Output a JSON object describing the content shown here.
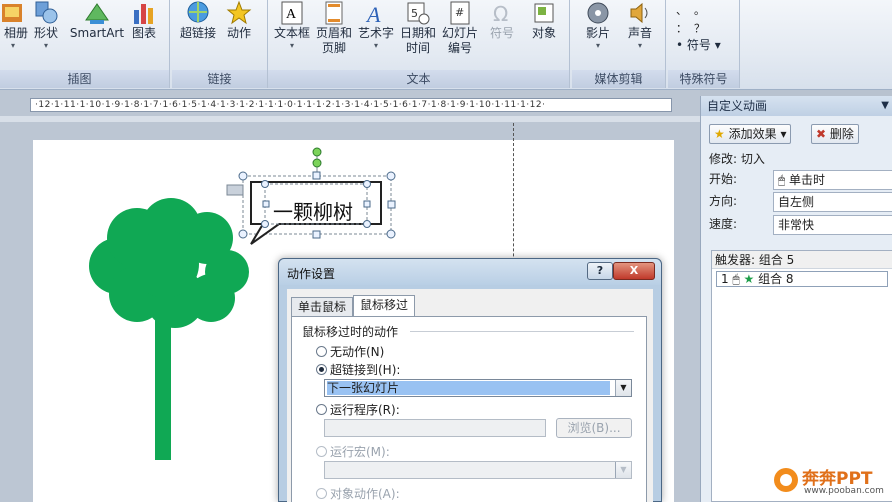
{
  "ribbon": {
    "groups": [
      {
        "label": "插图",
        "buttons": [
          {
            "label": "相册"
          },
          {
            "label": "形状"
          },
          {
            "label": "SmartArt"
          },
          {
            "label": "图表"
          }
        ]
      },
      {
        "label": "链接",
        "buttons": [
          {
            "label": "超链接"
          },
          {
            "label": "动作"
          }
        ]
      },
      {
        "label": "文本",
        "buttons": [
          {
            "label": "文本框"
          },
          {
            "label": "页眉和\n页脚"
          },
          {
            "label": "艺术字"
          },
          {
            "label": "日期和\n时间"
          },
          {
            "label": "幻灯片\n编号"
          },
          {
            "label": "符号"
          },
          {
            "label": "对象"
          }
        ]
      },
      {
        "label": "媒体剪辑",
        "buttons": [
          {
            "label": "影片"
          },
          {
            "label": "声音"
          }
        ]
      },
      {
        "label": "特殊符号",
        "buttons": [
          {
            "label": "符号"
          }
        ]
      }
    ],
    "special_symbols": [
      "、",
      "。",
      "：",
      "？",
      "；",
      "，",
      "·"
    ]
  },
  "ruler": {
    "ticks": "·12·1·11·1·10·1·9·1·8·1·7·1·6·1·5·1·4·1·3·1·2·1·1·1·0·1·1·1·2·1·3·1·4·1·5·1·6·1·7·1·8·1·9·1·10·1·11·1·12·"
  },
  "slide": {
    "callout_text": "一颗柳树"
  },
  "dialog": {
    "title": "动作设置",
    "help_label": "?",
    "close_label": "X",
    "tabs": [
      "单击鼠标",
      "鼠标移过"
    ],
    "section_label": "鼠标移过时的动作",
    "options": {
      "none": "无动作(N)",
      "hyperlink": "超链接到(H):",
      "run_program": "运行程序(R):",
      "run_macro": "运行宏(M):",
      "object_action": "对象动作(A):"
    },
    "hyperlink_value": "下一张幻灯片",
    "browse_label": "浏览(B)..."
  },
  "pane": {
    "title": "自定义动画",
    "add_effect": "添加效果",
    "delete": "删除",
    "modify_label": "修改: 切入",
    "start_label": "开始:",
    "start_value": "单击时",
    "direction_label": "方向:",
    "direction_value": "自左侧",
    "speed_label": "速度:",
    "speed_value": "非常快",
    "trigger": "触发器: 组合 5",
    "item_index": "1",
    "item_label": "组合 8"
  },
  "watermark": {
    "brand": "奔奔PPT",
    "url": "www.pooban.com"
  },
  "colors": {
    "tree_green": "#10a854",
    "selection_blue": "#99c2f2"
  }
}
